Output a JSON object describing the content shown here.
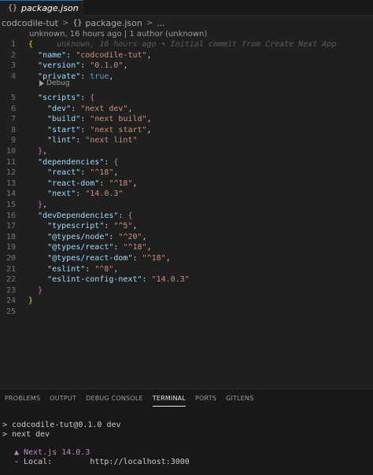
{
  "tab": {
    "icon": "{}",
    "label": "package.json"
  },
  "breadcrumb": {
    "folder": "codcodile-tut",
    "sep1": ">",
    "file_icon": "{}",
    "file": "package.json",
    "sep2": ">",
    "more": "..."
  },
  "blame": "unknown, 16 hours ago | 1 author (unknown)",
  "editor": {
    "ghost_blame": "unknown, 16 hours ago • Initial commit from Create Next App",
    "codelens": "Debug",
    "line_numbers": [
      "1",
      "2",
      "3",
      "4",
      "5",
      "6",
      "7",
      "8",
      "9",
      "10",
      "11",
      "12",
      "13",
      "14",
      "15",
      "16",
      "17",
      "18",
      "19",
      "20",
      "21",
      "22",
      "23",
      "24",
      "25"
    ],
    "name_key": "\"name\"",
    "name_val": "\"codcodile-tut\"",
    "version_key": "\"version\"",
    "version_val": "\"0.1.0\"",
    "private_key": "\"private\"",
    "private_val": "true",
    "scripts_key": "\"scripts\"",
    "dev_key": "\"dev\"",
    "dev_val": "\"next dev\"",
    "build_key": "\"build\"",
    "build_val": "\"next build\"",
    "start_key": "\"start\"",
    "start_val": "\"next start\"",
    "lint_key": "\"lint\"",
    "lint_val": "\"next lint\"",
    "deps_key": "\"dependencies\"",
    "react_key": "\"react\"",
    "react_val": "\"^18\"",
    "reactdom_key": "\"react-dom\"",
    "reactdom_val": "\"^18\"",
    "next_key": "\"next\"",
    "next_val": "\"14.0.3\"",
    "devdeps_key": "\"devDependencies\"",
    "ts_key": "\"typescript\"",
    "ts_val": "\"^5\"",
    "tnode_key": "\"@types/node\"",
    "tnode_val": "\"^20\"",
    "treact_key": "\"@types/react\"",
    "treact_val": "\"^18\"",
    "treactdom_key": "\"@types/react-dom\"",
    "treactdom_val": "\"^18\"",
    "eslint_key": "\"eslint\"",
    "eslint_val": "\"^8\"",
    "eslintnext_key": "\"eslint-config-next\"",
    "eslintnext_val": "\"14.0.3\""
  },
  "panel": {
    "tabs": [
      "PROBLEMS",
      "OUTPUT",
      "DEBUG CONSOLE",
      "TERMINAL",
      "PORTS",
      "GITLENS"
    ],
    "active_tab": "TERMINAL",
    "terminal": {
      "line1": "> codcodile-tut@0.1.0 dev",
      "line2": "> next dev",
      "next_marker": "▲",
      "next_label": "Next.js 14.0.3",
      "local_label": "- Local:",
      "local_url": "http://localhost:3000"
    }
  },
  "colors": {
    "key": "#9cdcfe",
    "string": "#ce9178",
    "keyword": "#569cd6",
    "brace_outer": "#ffd700",
    "brace_inner": "#da70d6",
    "accent": "#0078d4"
  }
}
